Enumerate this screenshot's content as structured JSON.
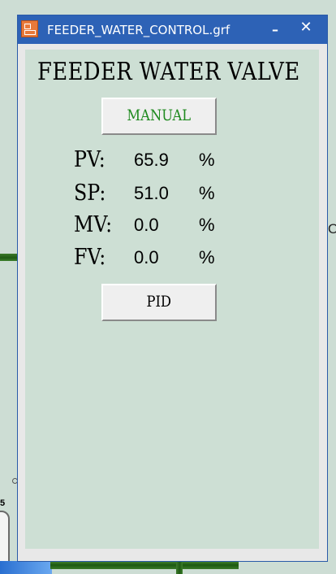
{
  "window": {
    "title": "FEEDER_WATER_CONTROL.grf",
    "minimize_label": "–",
    "close_label": "✕"
  },
  "panel": {
    "title": "FEEDER WATER VALVE",
    "mode_button": "MANUAL",
    "pid_button": "PID",
    "readings": [
      {
        "label": "PV:",
        "value": "65.9",
        "unit": "%"
      },
      {
        "label": "SP:",
        "value": "51.0",
        "unit": "%"
      },
      {
        "label": "MV:",
        "value": "0.0",
        "unit": "%"
      },
      {
        "label": "FV:",
        "value": "0.0",
        "unit": "%"
      }
    ]
  },
  "background": {
    "glyph_left": "5",
    "glyph_right": "O"
  },
  "colors": {
    "titlebar": "#2d62b6",
    "panel_bg": "#cddfd4",
    "manual_text": "#1f8a1f",
    "pipe_green": "#1f5a14"
  },
  "icons": {
    "app": "grf-app-icon",
    "minimize": "minimize-icon",
    "close": "close-icon"
  }
}
